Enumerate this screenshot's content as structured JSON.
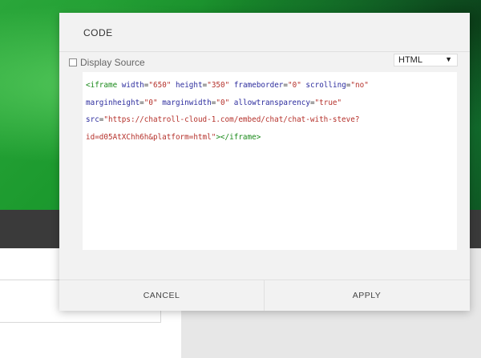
{
  "modal": {
    "title": "CODE",
    "display_source_label": "Display Source",
    "mode_select": {
      "value": "HTML",
      "arrow": "▼"
    },
    "code_lines": [
      [
        {
          "t": "tag",
          "v": "<iframe"
        },
        {
          "t": "plain",
          "v": " "
        },
        {
          "t": "attr",
          "v": "width"
        },
        {
          "t": "plain",
          "v": "="
        },
        {
          "t": "str",
          "v": "\"650\""
        },
        {
          "t": "plain",
          "v": " "
        },
        {
          "t": "attr",
          "v": "height"
        },
        {
          "t": "plain",
          "v": "="
        },
        {
          "t": "str",
          "v": "\"350\""
        },
        {
          "t": "plain",
          "v": " "
        },
        {
          "t": "attr",
          "v": "frameborder"
        },
        {
          "t": "plain",
          "v": "="
        },
        {
          "t": "str",
          "v": "\"0\""
        },
        {
          "t": "plain",
          "v": " "
        },
        {
          "t": "attr",
          "v": "scrolling"
        },
        {
          "t": "plain",
          "v": "="
        },
        {
          "t": "str",
          "v": "\"no\""
        }
      ],
      [
        {
          "t": "attr",
          "v": "marginheight"
        },
        {
          "t": "plain",
          "v": "="
        },
        {
          "t": "str",
          "v": "\"0\""
        },
        {
          "t": "plain",
          "v": " "
        },
        {
          "t": "attr",
          "v": "marginwidth"
        },
        {
          "t": "plain",
          "v": "="
        },
        {
          "t": "str",
          "v": "\"0\""
        },
        {
          "t": "plain",
          "v": " "
        },
        {
          "t": "attr",
          "v": "allowtransparency"
        },
        {
          "t": "plain",
          "v": "="
        },
        {
          "t": "str",
          "v": "\"true\""
        }
      ],
      [
        {
          "t": "attr",
          "v": "src"
        },
        {
          "t": "plain",
          "v": "="
        },
        {
          "t": "str",
          "v": "\"https://chatroll-cloud-1.com/embed/chat/chat-with-steve?"
        }
      ],
      [
        {
          "t": "str",
          "v": "id=d05AtXChh6h&platform=html\""
        },
        {
          "t": "tag",
          "v": "></iframe>"
        }
      ]
    ],
    "buttons": {
      "cancel": "CANCEL",
      "apply": "APPLY"
    }
  }
}
